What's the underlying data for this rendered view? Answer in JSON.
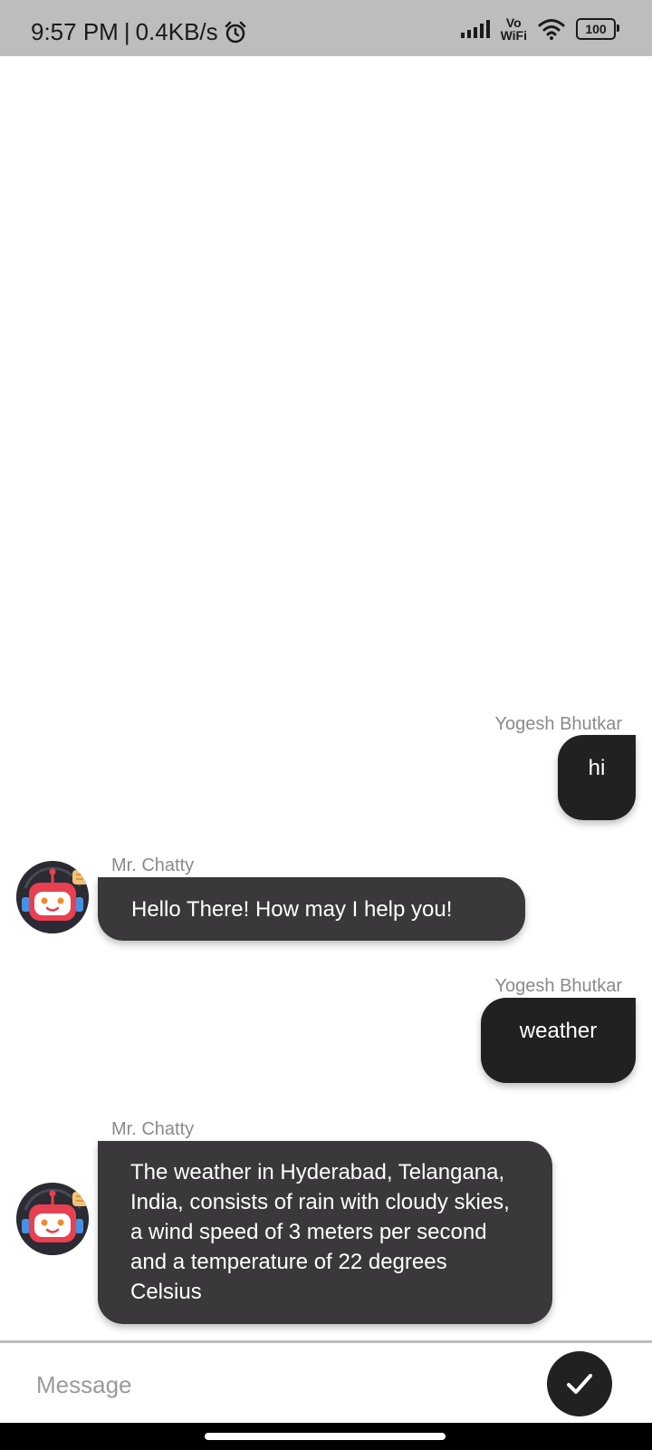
{
  "status_bar": {
    "time": "9:57 PM",
    "separator": "|",
    "speed": "0.4KB/s",
    "vo": "Vo",
    "wifi": "WiFi",
    "battery": "100"
  },
  "chat": {
    "messages": [
      {
        "sender": "Yogesh Bhutkar",
        "text": "hi"
      },
      {
        "sender": "Mr. Chatty",
        "text": "Hello There! How may I help you!"
      },
      {
        "sender": "Yogesh Bhutkar",
        "text": "weather"
      },
      {
        "sender": "Mr. Chatty",
        "text": "The weather in Hyderabad, Telangana, India, consists of rain with cloudy skies, a wind speed of 3 meters per second and a temperature of 22 degrees Celsius"
      }
    ]
  },
  "composer": {
    "placeholder": "Message",
    "value": ""
  },
  "icons": {
    "alarm": "alarm-icon",
    "signal": "signal-icon",
    "wifi": "wifi-icon",
    "battery": "battery-icon",
    "bot_avatar": "robot-avatar-icon",
    "send": "checkmark-icon"
  },
  "colors": {
    "user_bubble": "#212121",
    "bot_bubble": "#3a383a",
    "status_bar": "#bdbdbd"
  }
}
